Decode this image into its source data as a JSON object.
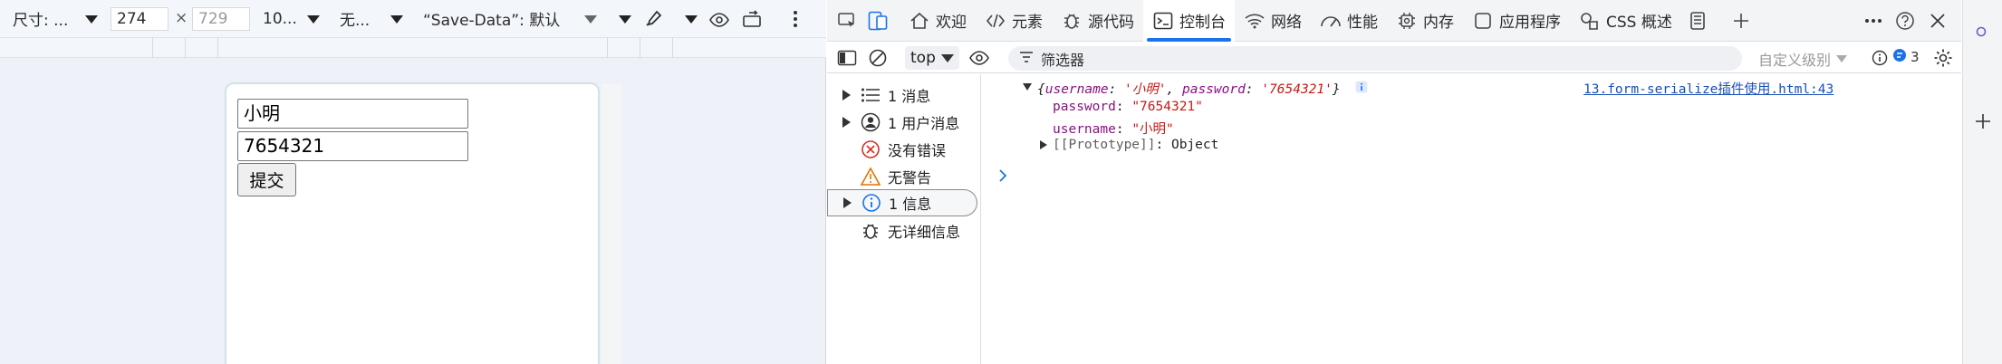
{
  "device_toolbar": {
    "dimensions_label": "尺寸: ...",
    "width_value": "274",
    "times_sign": "×",
    "height_placeholder": "729",
    "zoom_label": "10...",
    "throttle_label": "无...",
    "save_data_label": "“Save-Data”: 默认"
  },
  "page": {
    "username_value": "小明",
    "password_value": "7654321",
    "submit_label": "提交"
  },
  "devtools_tabs": [
    {
      "label": "欢迎",
      "icon": "home-icon"
    },
    {
      "label": "元素",
      "icon": "code-brackets-icon"
    },
    {
      "label": "源代码",
      "icon": "bug-icon"
    },
    {
      "label": "控制台",
      "icon": "terminal-icon"
    },
    {
      "label": "网络",
      "icon": "wifi-icon"
    },
    {
      "label": "性能",
      "icon": "gauge-icon"
    },
    {
      "label": "内存",
      "icon": "chip-icon"
    },
    {
      "label": "应用程序",
      "icon": "app-icon"
    },
    {
      "label": "CSS 概述",
      "icon": "css-overview-icon"
    }
  ],
  "console_toolbar": {
    "context": "top",
    "filter_placeholder": "筛选器",
    "level": "自定义级别",
    "issues_count": "3"
  },
  "sidebar": {
    "items": [
      {
        "label": "1 消息",
        "icon": "list-icon"
      },
      {
        "label": "1 用户消息",
        "icon": "user-icon"
      },
      {
        "label": "没有错误",
        "icon": "error-icon"
      },
      {
        "label": "无警告",
        "icon": "warning-icon"
      },
      {
        "label": "1 信息",
        "icon": "info-icon"
      },
      {
        "label": "无详细信息",
        "icon": "verbose-bug-icon"
      }
    ]
  },
  "console": {
    "summary_open": "{",
    "username_key": "username",
    "username_val": "'小明'",
    "password_key": "password",
    "password_val": "'7654321'",
    "summary_close": "}",
    "source_link": "13.form-serialize插件使用.html:43",
    "prop1_key": "password",
    "prop1_val": "\"7654321\"",
    "prop2_key": "username",
    "prop2_val": "\"小明\"",
    "proto_key": "[[Prototype]]",
    "proto_val": "Object",
    "colon": ":",
    "comma": ","
  },
  "colors": {
    "accent": "#1a73e8",
    "key": "#881280",
    "string": "#c41a16"
  }
}
